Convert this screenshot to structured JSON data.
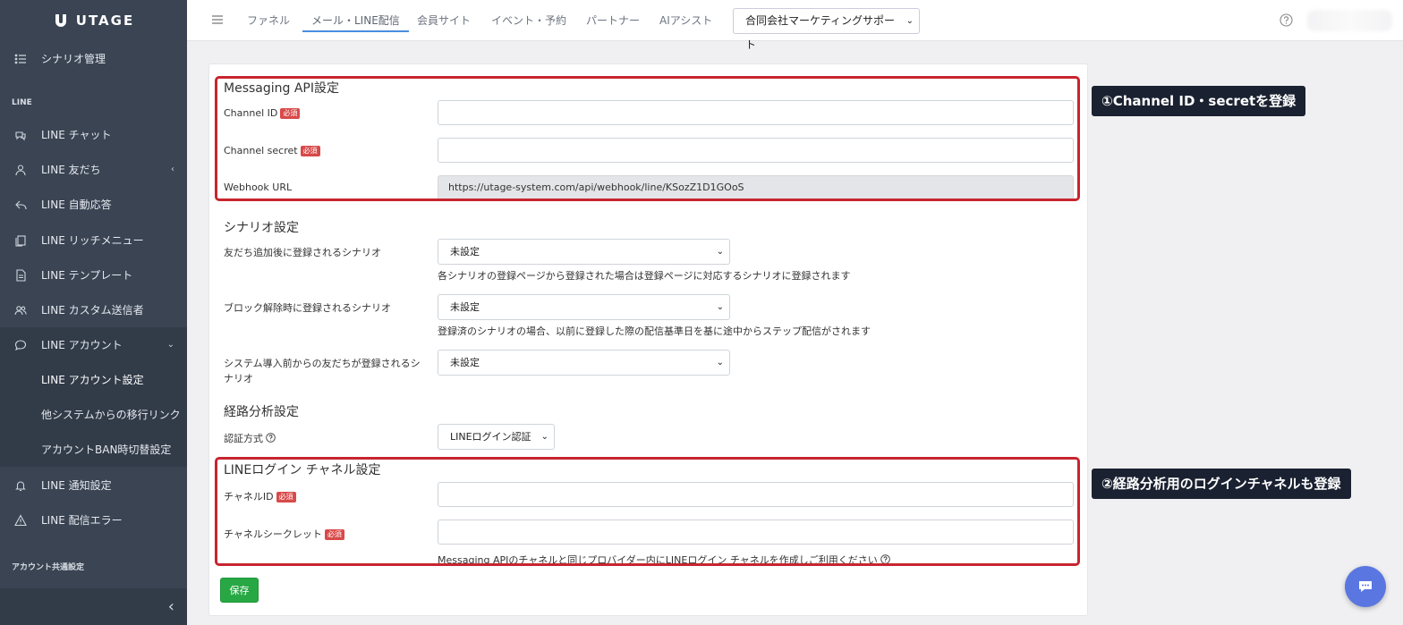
{
  "brand": {
    "name": "UTAGE"
  },
  "sidebar": {
    "items": [
      {
        "label": "シナリオ管理",
        "icon": "list-icon"
      },
      {
        "label": "LINE チャット",
        "icon": "chat-icon"
      },
      {
        "label": "LINE 友だち",
        "icon": "user-icon",
        "chevron": "‹"
      },
      {
        "label": "LINE 自動応答",
        "icon": "reply-icon"
      },
      {
        "label": "LINE リッチメニュー",
        "icon": "copy-icon"
      },
      {
        "label": "LINE テンプレート",
        "icon": "file-icon"
      },
      {
        "label": "LINE カスタム送信者",
        "icon": "users-icon"
      },
      {
        "label": "LINE アカウント",
        "icon": "speech-icon",
        "chevron": "⌄"
      },
      {
        "label": "LINE アカウント設定"
      },
      {
        "label": "他システムからの移行リンク"
      },
      {
        "label": "アカウントBAN時切替設定"
      },
      {
        "label": "LINE 通知設定",
        "icon": "bell-icon"
      },
      {
        "label": "LINE 配信エラー",
        "icon": "warning-icon"
      }
    ],
    "sections": {
      "line": "LINE",
      "common": "アカウント共通設定"
    },
    "collapse_icon": "‹"
  },
  "topbar": {
    "tabs": [
      "ファネル",
      "メール・LINE配信",
      "会員サイト",
      "イベント・予約",
      "パートナー",
      "AIアシスト"
    ],
    "active_tab": "メール・LINE配信",
    "account_select": "合同会社マーケティングサポート",
    "select_arrow": "⌄"
  },
  "form": {
    "messaging": {
      "heading": "Messaging API設定",
      "channel_id_label": "Channel ID",
      "channel_secret_label": "Channel secret",
      "webhook_label": "Webhook URL",
      "webhook_value": "https://utage-system.com/api/webhook/line/KSozZ1D1GOoS"
    },
    "required_badge": "必須",
    "scenario": {
      "heading": "シナリオ設定",
      "friend_add_label": "友だち追加後に登録されるシナリオ",
      "friend_add_value": "未設定",
      "friend_add_hint": "各シナリオの登録ページから登録された場合は登録ページに対応するシナリオに登録されます",
      "unblock_label": "ブロック解除時に登録されるシナリオ",
      "unblock_value": "未設定",
      "unblock_hint": "登録済のシナリオの場合、以前に登録した際の配信基準日を基に途中からステップ配信がされます",
      "pre_system_label_1": "システム導入前からの友だちが登録されるシ",
      "pre_system_label_2": "ナリオ",
      "pre_system_value": "未設定"
    },
    "route": {
      "heading": "経路分析設定",
      "auth_label": "認証方式",
      "auth_value": "LINEログイン認証"
    },
    "login_channel": {
      "heading": "LINEログイン チャネル設定",
      "channel_id_label": "チャネルID",
      "channel_secret_label": "チャネルシークレット",
      "hint": "Messaging APIのチャネルと同じプロバイダー内にLINEログイン チャネルを作成しご利用ください"
    },
    "save_label": "保存"
  },
  "callouts": {
    "first": "①Channel ID・secretを登録",
    "second": "②経路分析用のログインチャネルも登録"
  },
  "colors": {
    "highlight": "#c7252f",
    "save": "#27a844",
    "sidebar": "#3a4453",
    "fab": "#5a76e0"
  }
}
